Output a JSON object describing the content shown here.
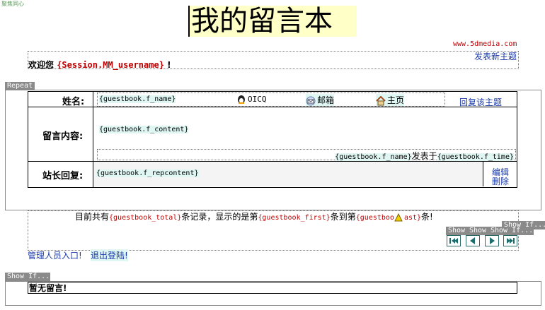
{
  "top": {
    "corner_text": "聚焦同心",
    "title": "我的留言本",
    "site_url": "www.5dmedia.com",
    "new_topic_link": "发表新主题"
  },
  "welcome": {
    "prefix": "欢迎您",
    "session_var": "{Session.MM_username}",
    "suffix": "!"
  },
  "repeat_tag": "Repeat",
  "entry": {
    "name_label": "姓名:",
    "name_value": "{guestbook.f_name}",
    "oicq_label": "OICQ",
    "email_label": "邮箱",
    "homepage_label": "主页",
    "reply_link": "回复该主题",
    "content_label": "留言内容:",
    "content_value": "{guestbook.f_content}",
    "posted_name": "{guestbook.f_name}",
    "posted_at_text": "发表于",
    "posted_time": "{guestbook.f_time}",
    "admin_reply_label": "站长回复:",
    "admin_reply_value": "{guestbook.f_repcontent}",
    "edit_link": "编辑",
    "delete_link": "删除"
  },
  "paging": {
    "text_1": "目前共有",
    "total": "{guestbook_total}",
    "text_2": "条记录，显示的是第",
    "first": "{guestbook_first}",
    "text_3": "条到第",
    "last": "{guestboo",
    "last_tail": "ast}",
    "text_4": "条!",
    "show_if_tags": [
      "Show If...",
      "Show If...",
      "Show If...",
      "Show If..."
    ],
    "show_labels": [
      "Show",
      "Show",
      "Show",
      "Show"
    ],
    "admin_entry": "管理人员入口!",
    "logout": "退出登陆!"
  },
  "empty": {
    "show_if_tag": "Show If...",
    "message": "暂无留言!"
  }
}
